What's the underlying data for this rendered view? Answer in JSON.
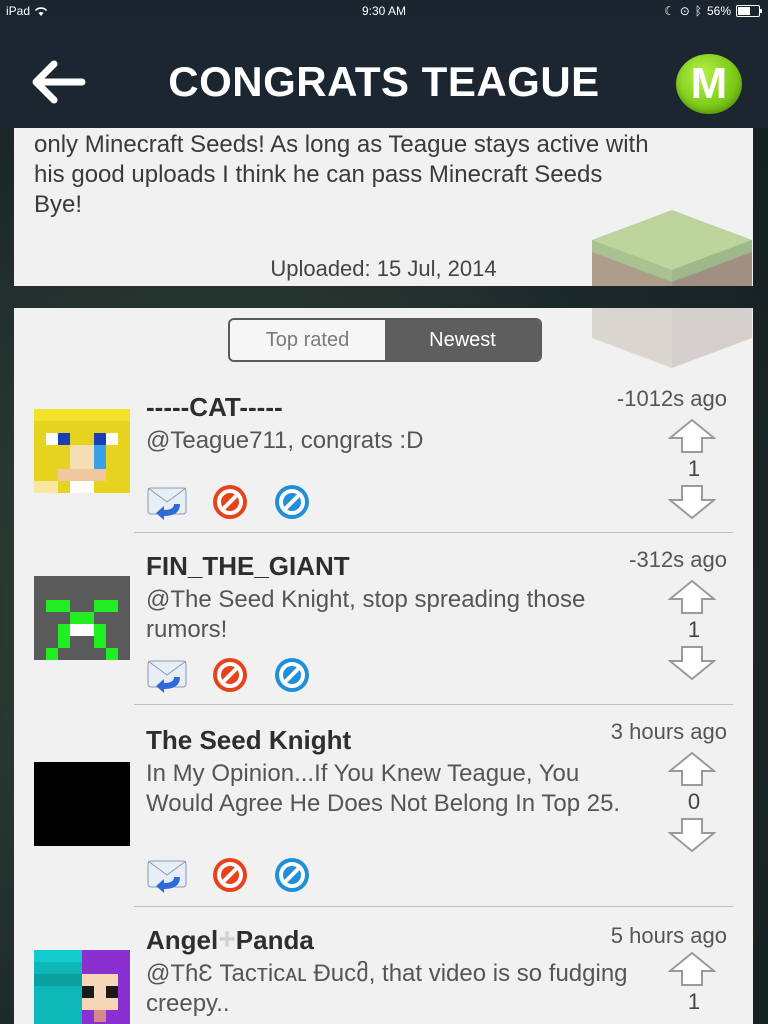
{
  "status_bar": {
    "device": "iPad",
    "time": "9:30 AM",
    "battery": "56%",
    "battery_level": 0.56
  },
  "nav": {
    "title": "CONGRATS TEAGUE",
    "logo_letter": "M"
  },
  "description": {
    "text": "only Minecraft Seeds! As long as Teague stays active with\nhis good uploads I think he can pass Minecraft Seeds\nBye!",
    "uploaded": "Uploaded: 15 Jul, 2014"
  },
  "tabs": {
    "top_rated": "Top rated",
    "newest": "Newest",
    "active": "newest"
  },
  "comments": [
    {
      "username": "-----CAT-----",
      "time": "-1012s ago",
      "message": "@Teague711, congrats :D",
      "score": "1",
      "avatar": "blonde-skin"
    },
    {
      "username": "FIN_THE_GIANT",
      "time": "-312s ago",
      "message": "@The Seed Knight, stop spreading those rumors!",
      "score": "1",
      "avatar": "creeper-skin"
    },
    {
      "username": "The Seed Knight",
      "time": "3 hours ago",
      "message": "In My Opinion...If You Knew Teague, You Would Agree He Does Not Belong In Top 25.",
      "score": "0",
      "avatar": "black-skin"
    },
    {
      "username_part1": "Angel",
      "username_part2": "Panda",
      "time": "5 hours ago",
      "message": "@TɦԐ Tacтicᴀʟ Đucმ, that video is so fudging creepy..",
      "score": "1",
      "avatar": "purple-hair-skin"
    }
  ],
  "colors": {
    "nav_bg": "#1b2631",
    "logo_green": "#7fcd19",
    "card_bg": "#f1f1f1",
    "active_tab": "#5e5e5e"
  }
}
